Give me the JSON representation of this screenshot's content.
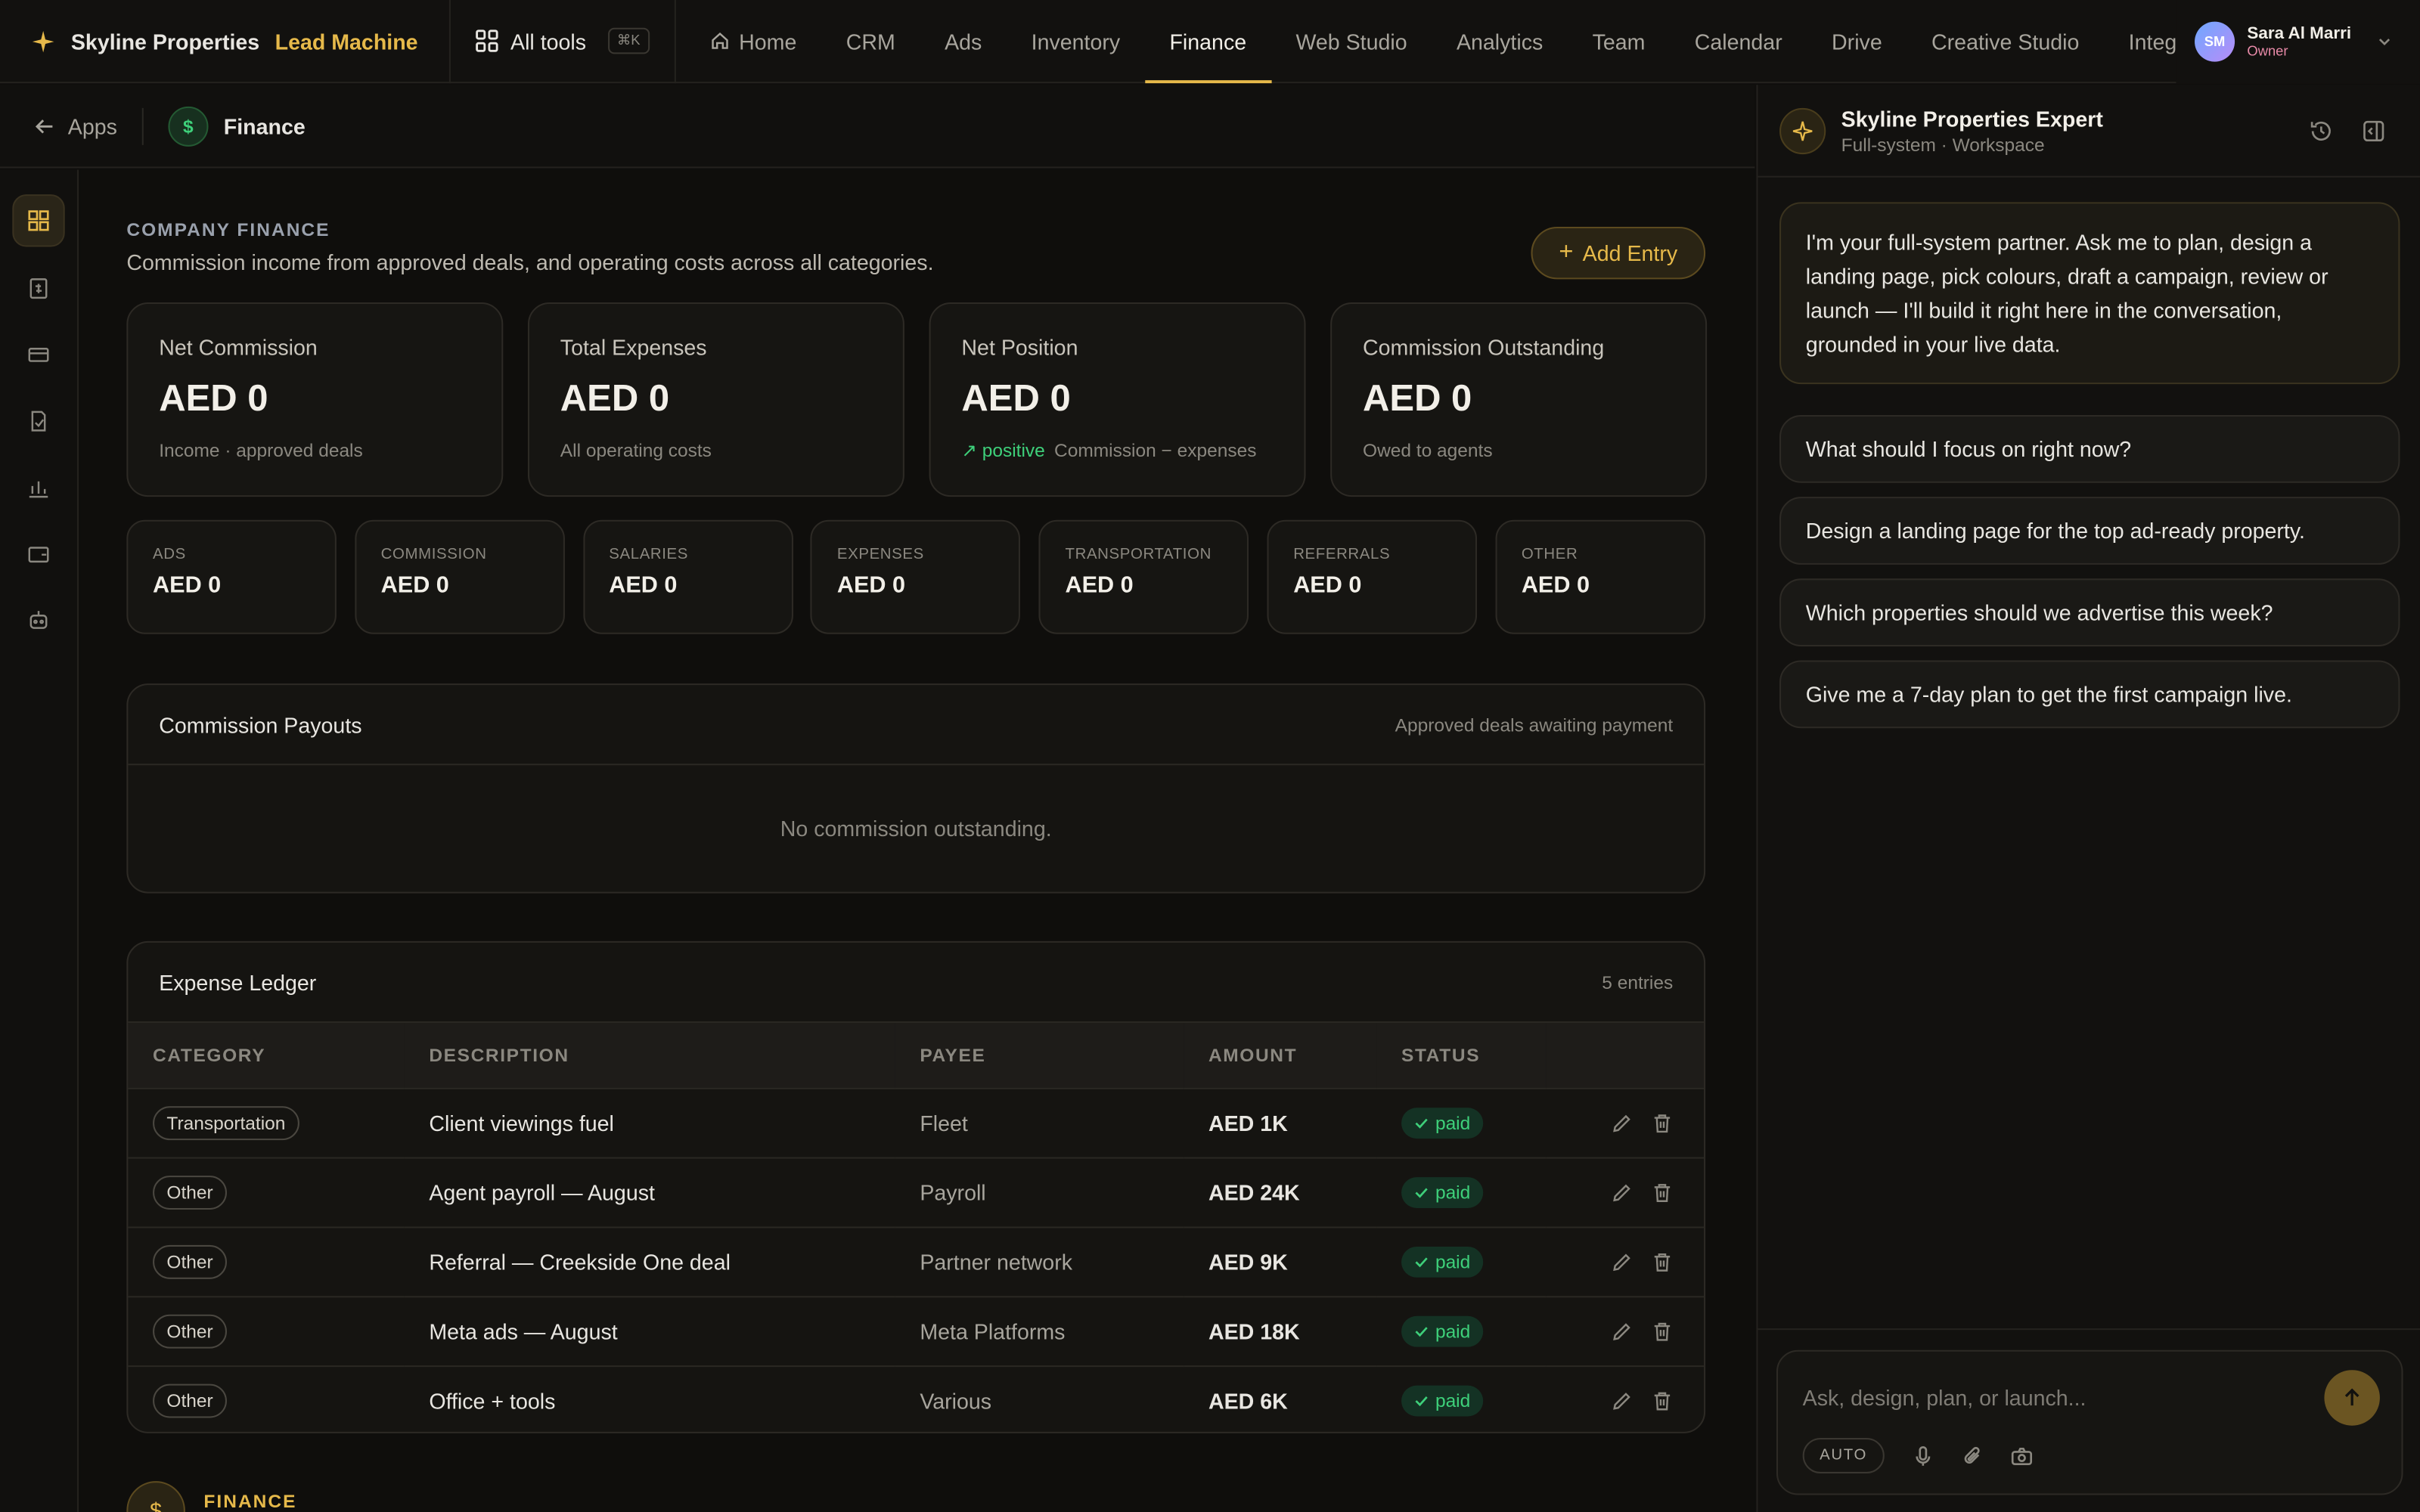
{
  "brand": {
    "name": "Skyline Properties",
    "accent": "Lead Machine",
    "accent_color": "#e6b94a"
  },
  "all_tools": {
    "label": "All tools",
    "shortcut": "⌘K"
  },
  "nav": [
    "Home",
    "CRM",
    "Ads",
    "Inventory",
    "Finance",
    "Web Studio",
    "Analytics",
    "Team",
    "Calendar",
    "Drive",
    "Creative Studio",
    "Integ"
  ],
  "nav_active": "Finance",
  "user": {
    "initials": "SM",
    "name": "Sara Al Marri",
    "role": "Owner"
  },
  "breadcrumb": {
    "back": "Apps",
    "current": "Finance"
  },
  "finance": {
    "eyebrow": "COMPANY FINANCE",
    "subtitle": "Commission income from approved deals, and operating costs across all categories.",
    "add_entry": "Add Entry",
    "cards": [
      {
        "label": "Net Commission",
        "value": "AED 0",
        "sub": "Income · approved deals"
      },
      {
        "label": "Total Expenses",
        "value": "AED 0",
        "sub": "All operating costs"
      },
      {
        "label": "Net Position",
        "value": "AED 0",
        "positive": "positive",
        "sub": "Commission − expenses"
      },
      {
        "label": "Commission Outstanding",
        "value": "AED 0",
        "sub": "Owed to agents"
      }
    ],
    "categories": [
      {
        "label": "ADS",
        "value": "AED 0"
      },
      {
        "label": "COMMISSION",
        "value": "AED 0"
      },
      {
        "label": "SALARIES",
        "value": "AED 0"
      },
      {
        "label": "EXPENSES",
        "value": "AED 0"
      },
      {
        "label": "TRANSPORTATION",
        "value": "AED 0"
      },
      {
        "label": "REFERRALS",
        "value": "AED 0"
      },
      {
        "label": "OTHER",
        "value": "AED 0"
      }
    ],
    "payouts": {
      "title": "Commission Payouts",
      "meta": "Approved deals awaiting payment",
      "empty": "No commission outstanding."
    },
    "ledger": {
      "title": "Expense Ledger",
      "count": "5 entries",
      "columns": [
        "CATEGORY",
        "DESCRIPTION",
        "PAYEE",
        "AMOUNT",
        "STATUS"
      ],
      "rows": [
        {
          "category": "Transportation",
          "description": "Client viewings fuel",
          "payee": "Fleet",
          "amount": "AED 1K",
          "status": "paid"
        },
        {
          "category": "Other",
          "description": "Agent payroll — August",
          "payee": "Payroll",
          "amount": "AED 24K",
          "status": "paid"
        },
        {
          "category": "Other",
          "description": "Referral — Creekside One deal",
          "payee": "Partner network",
          "amount": "AED 9K",
          "status": "paid"
        },
        {
          "category": "Other",
          "description": "Meta ads — August",
          "payee": "Meta Platforms",
          "amount": "AED 18K",
          "status": "paid"
        },
        {
          "category": "Other",
          "description": "Office + tools",
          "payee": "Various",
          "amount": "AED 6K",
          "status": "paid"
        }
      ]
    },
    "footer_label": "FINANCE"
  },
  "chat": {
    "title": "Skyline Properties Expert",
    "subtitle": "Full-system · Workspace",
    "intro": "I'm your full-system partner. Ask me to plan, design a landing page, pick colours, draft a campaign, review or launch — I'll build it right here in the conversation, grounded in your live data.",
    "suggestions": [
      "What should I focus on right now?",
      "Design a landing page for the top ad-ready property.",
      "Which properties should we advertise this week?",
      "Give me a 7-day plan to get the first campaign live."
    ],
    "placeholder": "Ask, design, plan, or launch...",
    "mode": "AUTO"
  }
}
